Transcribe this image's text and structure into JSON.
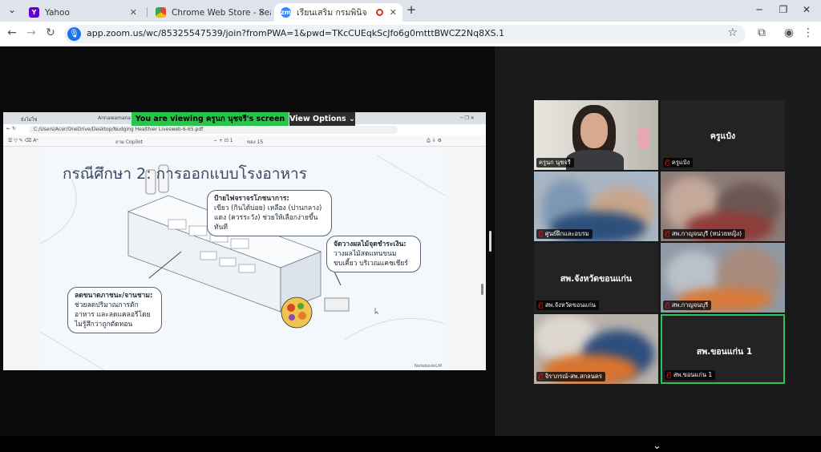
{
  "tabs": [
    {
      "title": "Yahoo",
      "icon": "yahoo-icon",
      "color": "#6001d2"
    },
    {
      "title": "Chrome Web Store - Search Re",
      "icon": "chrome-webstore-icon",
      "color": "#e0452e"
    },
    {
      "title": "เรียนเสริม กรมพินิจ",
      "icon": "zoom-icon",
      "color": "#2d8cff"
    }
  ],
  "address": {
    "url": "app.zoom.us/wc/85325547539/join?fromPWA=1&pwd=TKcCUEqkScJfo6g0mtttBWCZ2Nq8XS.1"
  },
  "share": {
    "banner": "You are viewing  ครูนก นุชจรี's screen",
    "view_options": "View Options",
    "inner_tabs": [
      "ยังไม่ใช่",
      "Annawamana (77)"
    ],
    "inner_url": "C:/Users/Acer/OneDrive/Desktop/Nudging Healthier Livesweb-6-65.pdf",
    "pdf_tools": [
      "ถาม Copilot",
      "ของ 15"
    ],
    "slide_title": "กรณีศึกษา 2: การออกแบบโรงอาหาร",
    "bubbles": [
      {
        "head": "ป้ายไฟจราจรโภชนาการ:",
        "body": "เขียว (กินได้บ่อย) เหลือง (ปานกลาง) แดง (ควรระวัง) ช่วยให้เลือกง่ายขึ้นทันที"
      },
      {
        "head": "จัดวางผลไม้จุดชำระเงิน:",
        "body": "วางผลไม้สดแทนขนมขบเคี้ยว บริเวณแคชเชียร์"
      },
      {
        "head": "ลดขนาดภาชนะ/จานชาม:",
        "body": "ช่วยลดปริมาณการตักอาหาร และลดแคลอรีโดยไม่รู้สึกว่าถูกตัดทอน"
      }
    ],
    "watermark": "NotebookLM"
  },
  "gallery": [
    {
      "name": "ครูนก นุชจรี",
      "big": ""
    },
    {
      "name": "ครูแป๋ง",
      "big": "ครูแป๋ง"
    },
    {
      "name": "ศูนย์ฝึกและอบรม",
      "big": ""
    },
    {
      "name": "สพ.กาญจนบุรี (หน่วยหญิง)",
      "big": ""
    },
    {
      "name": "สพ.จังหวัดขอนแก่น",
      "big": "สพ.จังหวัดขอนแก่น"
    },
    {
      "name": "สพ.กาญจนบุรี",
      "big": ""
    },
    {
      "name": "จิราภรณ์-สพ.สกลนคร",
      "big": ""
    },
    {
      "name": "สพ.ขอนแก่น 1",
      "big": "สพ.ขอนแก่น 1"
    }
  ]
}
